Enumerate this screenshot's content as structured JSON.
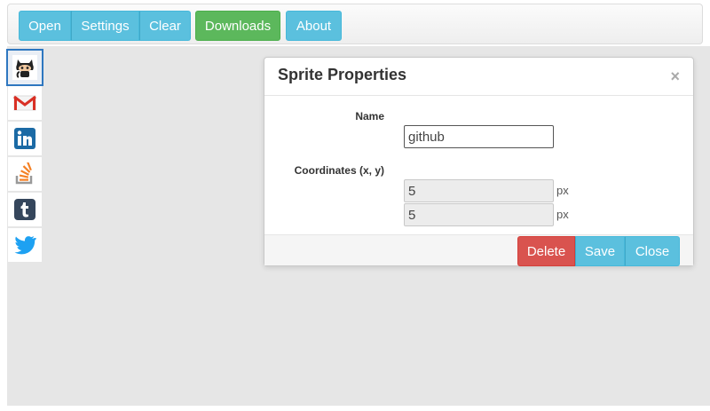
{
  "toolbar": {
    "open_label": "Open",
    "settings_label": "Settings",
    "clear_label": "Clear",
    "downloads_label": "Downloads",
    "about_label": "About"
  },
  "sprites": [
    "github",
    "gmail",
    "linkedin",
    "stackoverflow",
    "tumblr",
    "twitter"
  ],
  "modal": {
    "title": "Sprite Properties",
    "close_glyph": "×",
    "name_label": "Name",
    "name_value": "github",
    "coords_label": "Coordinates (x, y)",
    "x_value": "5",
    "y_value": "5",
    "unit": "px",
    "delete_label": "Delete",
    "save_label": "Save",
    "close_label": "Close"
  },
  "colors": {
    "info": "#5bc0de",
    "success": "#5cb85c",
    "danger": "#d9534f"
  }
}
